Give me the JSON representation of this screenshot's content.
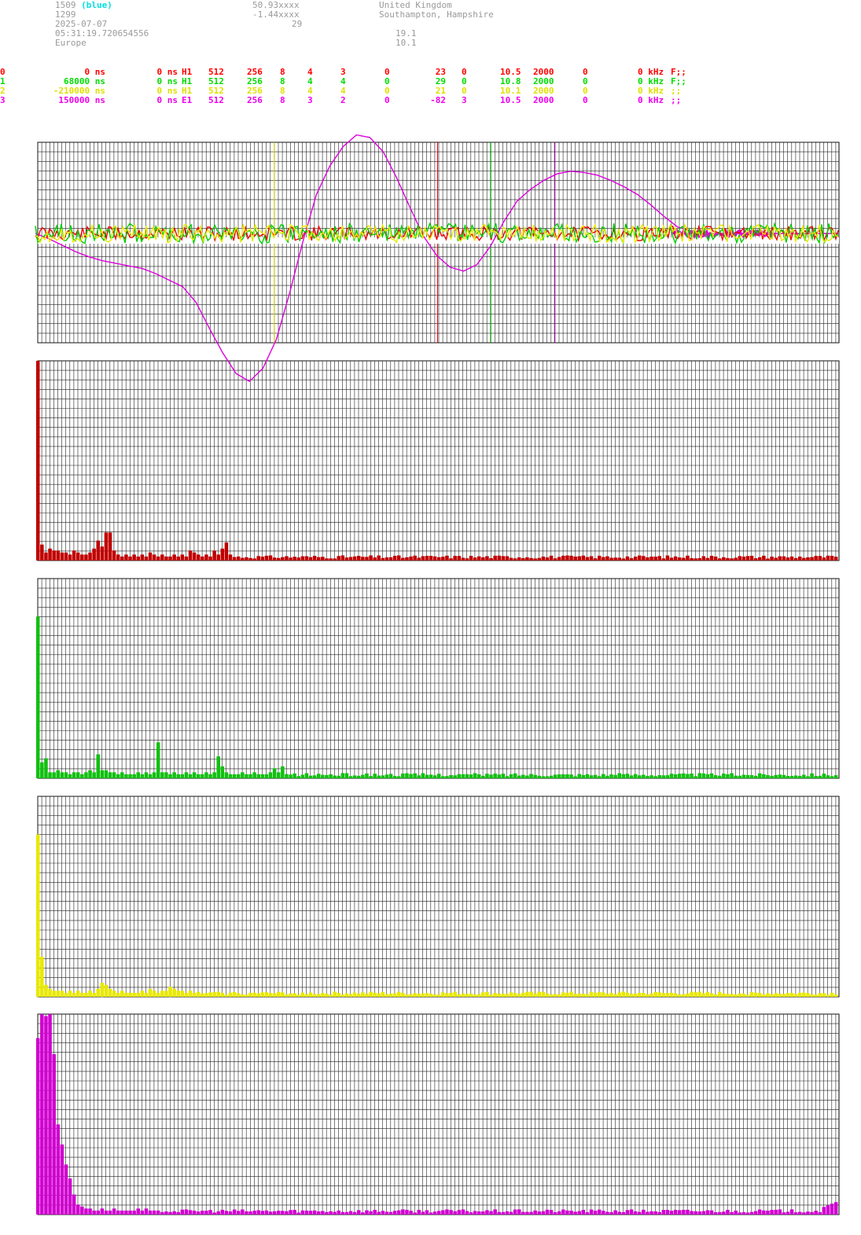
{
  "header": {
    "station_id": "1509",
    "station_color_label": "(blue)",
    "number": "1299",
    "date": "2025-07-07",
    "time": "05:31:19.720654556",
    "region": "Europe",
    "latitude": "50.93xxxx",
    "longitude": "-1.44xxxx",
    "altitude": "29",
    "country": "United Kingdom",
    "place": "Southampton, Hampshire",
    "value_a": "19.1",
    "value_b": "10.1"
  },
  "channels": [
    {
      "idx": "0",
      "offset": "0 ns",
      "delay": "0 ns",
      "type": "H1",
      "n": "512",
      "m": "256",
      "a": "8",
      "b": "4",
      "c": "3",
      "d": "0",
      "e": "23",
      "f": "0",
      "g": "10.5",
      "h": "2000",
      "i": "0",
      "j": "0 kHz",
      "flag": "F;;",
      "color": "#ff0000"
    },
    {
      "idx": "1",
      "offset": "68000 ns",
      "delay": "0 ns",
      "type": "H1",
      "n": "512",
      "m": "256",
      "a": "8",
      "b": "4",
      "c": "4",
      "d": "0",
      "e": "29",
      "f": "0",
      "g": "10.8",
      "h": "2000",
      "i": "0",
      "j": "0 kHz",
      "flag": "F;;",
      "color": "#00dd00"
    },
    {
      "idx": "2",
      "offset": "-210000 ns",
      "delay": "0 ns",
      "type": "H1",
      "n": "512",
      "m": "256",
      "a": "8",
      "b": "4",
      "c": "4",
      "d": "0",
      "e": "21",
      "f": "0",
      "g": "10.1",
      "h": "2000",
      "i": "0",
      "j": "0 kHz",
      "flag": ";;",
      "color": "#e0e000"
    },
    {
      "idx": "3",
      "offset": "150000 ns",
      "delay": "0 ns",
      "type": "E1",
      "n": "512",
      "m": "256",
      "a": "8",
      "b": "3",
      "c": "2",
      "d": "0",
      "e": "-82",
      "f": "3",
      "g": "10.5",
      "h": "2000",
      "i": "0",
      "j": "0 kHz",
      "flag": ";;",
      "color": "#ee00ee"
    }
  ],
  "chart_data": [
    {
      "type": "line",
      "series": [
        {
          "key": "ch3",
          "color": "#dd00dd",
          "values": [
            0,
            -4,
            -9,
            -14,
            -18,
            -21,
            -23,
            -25,
            -27,
            -31,
            -36,
            -41,
            -53,
            -73,
            -92,
            -108,
            -114,
            -104,
            -82,
            -46,
            -6,
            30,
            52,
            67,
            76,
            74,
            63,
            43,
            20,
            -2,
            -17,
            -26,
            -29,
            -24,
            -10,
            9,
            25,
            34,
            41,
            46,
            48,
            47,
            45,
            41,
            36,
            30,
            22,
            13,
            5,
            2,
            0,
            0,
            0,
            0,
            0,
            0,
            0,
            0,
            0,
            0,
            0
          ]
        },
        {
          "key": "ch0",
          "color": "#ee0000",
          "noise": true,
          "amp": 7,
          "seed": 11
        },
        {
          "key": "ch1",
          "color": "#00cc00",
          "noise": true,
          "amp": 10,
          "seed": 23
        },
        {
          "key": "ch2",
          "color": "#e8e800",
          "noise": true,
          "amp": 9,
          "seed": 37
        }
      ],
      "markers": [
        {
          "x": 0.295,
          "color": "#e0e000"
        },
        {
          "x": 0.499,
          "color": "#ff0000"
        },
        {
          "x": 0.565,
          "color": "#00cc00"
        },
        {
          "x": 0.645,
          "color": "#aa00aa"
        }
      ],
      "grid": true
    },
    {
      "type": "bar",
      "color": "#c00000",
      "max": 100,
      "peaks": [
        [
          0,
          100
        ],
        [
          1,
          8
        ],
        [
          2,
          4
        ],
        [
          3,
          6
        ],
        [
          4,
          5
        ],
        [
          5,
          5
        ],
        [
          6,
          4
        ],
        [
          7,
          4
        ],
        [
          8,
          3
        ],
        [
          9,
          5
        ],
        [
          10,
          4
        ],
        [
          11,
          3
        ],
        [
          12,
          3
        ],
        [
          13,
          4
        ],
        [
          14,
          6
        ],
        [
          15,
          10
        ],
        [
          16,
          7
        ],
        [
          17,
          14
        ],
        [
          18,
          14
        ],
        [
          19,
          5
        ],
        [
          20,
          3
        ],
        [
          21,
          2
        ],
        [
          22,
          3
        ],
        [
          23,
          2
        ],
        [
          24,
          3
        ],
        [
          25,
          2
        ],
        [
          26,
          3
        ],
        [
          27,
          2
        ],
        [
          28,
          4
        ],
        [
          29,
          3
        ],
        [
          30,
          2
        ],
        [
          31,
          3
        ],
        [
          32,
          2
        ],
        [
          33,
          2
        ],
        [
          34,
          3
        ],
        [
          35,
          2
        ],
        [
          36,
          3
        ],
        [
          37,
          2
        ],
        [
          38,
          5
        ],
        [
          39,
          4
        ],
        [
          40,
          3
        ],
        [
          41,
          2
        ],
        [
          42,
          3
        ],
        [
          43,
          2
        ],
        [
          44,
          5
        ],
        [
          45,
          3
        ],
        [
          46,
          6
        ],
        [
          47,
          9
        ],
        [
          48,
          3
        ]
      ]
    },
    {
      "type": "bar",
      "color": "#10c010",
      "max": 100,
      "peaks": [
        [
          0,
          81
        ],
        [
          1,
          8
        ],
        [
          2,
          10
        ],
        [
          3,
          3
        ],
        [
          4,
          3
        ],
        [
          5,
          4
        ],
        [
          6,
          3
        ],
        [
          7,
          3
        ],
        [
          8,
          2
        ],
        [
          9,
          3
        ],
        [
          10,
          3
        ],
        [
          11,
          2
        ],
        [
          12,
          3
        ],
        [
          13,
          4
        ],
        [
          14,
          3
        ],
        [
          15,
          12
        ],
        [
          16,
          4
        ],
        [
          17,
          4
        ],
        [
          18,
          3
        ],
        [
          19,
          3
        ],
        [
          20,
          2
        ],
        [
          21,
          3
        ],
        [
          22,
          2
        ],
        [
          23,
          2
        ],
        [
          24,
          2
        ],
        [
          25,
          3
        ],
        [
          26,
          2
        ],
        [
          27,
          3
        ],
        [
          28,
          2
        ],
        [
          29,
          3
        ],
        [
          30,
          18
        ],
        [
          31,
          3
        ],
        [
          32,
          3
        ],
        [
          33,
          2
        ],
        [
          34,
          3
        ],
        [
          35,
          2
        ],
        [
          36,
          2
        ],
        [
          37,
          3
        ],
        [
          38,
          2
        ],
        [
          39,
          3
        ],
        [
          40,
          2
        ],
        [
          41,
          2
        ],
        [
          42,
          3
        ],
        [
          43,
          2
        ],
        [
          44,
          3
        ],
        [
          45,
          11
        ],
        [
          46,
          6
        ],
        [
          47,
          3
        ],
        [
          48,
          2
        ],
        [
          49,
          2
        ],
        [
          50,
          2
        ],
        [
          51,
          3
        ],
        [
          52,
          2
        ],
        [
          53,
          2
        ],
        [
          54,
          3
        ],
        [
          55,
          2
        ],
        [
          56,
          2
        ],
        [
          57,
          2
        ],
        [
          58,
          3
        ],
        [
          59,
          5
        ],
        [
          60,
          3
        ],
        [
          61,
          6
        ]
      ]
    },
    {
      "type": "bar",
      "color": "#e8e800",
      "max": 100,
      "peaks": [
        [
          0,
          81
        ],
        [
          1,
          20
        ],
        [
          2,
          6
        ],
        [
          3,
          4
        ],
        [
          4,
          3
        ],
        [
          5,
          3
        ],
        [
          6,
          3
        ],
        [
          7,
          2
        ],
        [
          8,
          3
        ],
        [
          9,
          2
        ],
        [
          10,
          3
        ],
        [
          11,
          2
        ],
        [
          12,
          2
        ],
        [
          13,
          3
        ],
        [
          14,
          2
        ],
        [
          15,
          4
        ],
        [
          16,
          7
        ],
        [
          17,
          6
        ],
        [
          18,
          4
        ],
        [
          19,
          3
        ],
        [
          20,
          2
        ],
        [
          21,
          3
        ],
        [
          22,
          2
        ],
        [
          23,
          2
        ],
        [
          24,
          2
        ],
        [
          25,
          2
        ],
        [
          26,
          3
        ],
        [
          27,
          2
        ],
        [
          28,
          4
        ],
        [
          29,
          3
        ],
        [
          30,
          2
        ],
        [
          31,
          3
        ],
        [
          32,
          3
        ],
        [
          33,
          5
        ],
        [
          34,
          4
        ],
        [
          35,
          3
        ],
        [
          36,
          3
        ],
        [
          37,
          2
        ],
        [
          38,
          3
        ],
        [
          39,
          2
        ]
      ]
    },
    {
      "type": "bar",
      "color": "#d000d0",
      "max": 100,
      "peaks": [
        [
          0,
          88
        ],
        [
          1,
          100
        ],
        [
          2,
          99
        ],
        [
          3,
          100
        ],
        [
          4,
          80
        ],
        [
          5,
          45
        ],
        [
          6,
          35
        ],
        [
          7,
          25
        ],
        [
          8,
          18
        ],
        [
          9,
          10
        ],
        [
          10,
          5
        ],
        [
          11,
          4
        ],
        [
          12,
          3
        ],
        [
          13,
          3
        ],
        [
          14,
          2
        ],
        [
          15,
          2
        ],
        [
          16,
          3
        ],
        [
          17,
          2
        ],
        [
          18,
          2
        ],
        [
          19,
          3
        ],
        [
          20,
          2
        ],
        [
          21,
          2
        ],
        [
          22,
          2
        ],
        [
          23,
          2
        ],
        [
          24,
          2
        ],
        [
          25,
          3
        ],
        [
          26,
          2
        ],
        [
          27,
          3
        ],
        [
          28,
          2
        ],
        [
          29,
          2
        ],
        [
          30,
          2
        ]
      ]
    }
  ]
}
